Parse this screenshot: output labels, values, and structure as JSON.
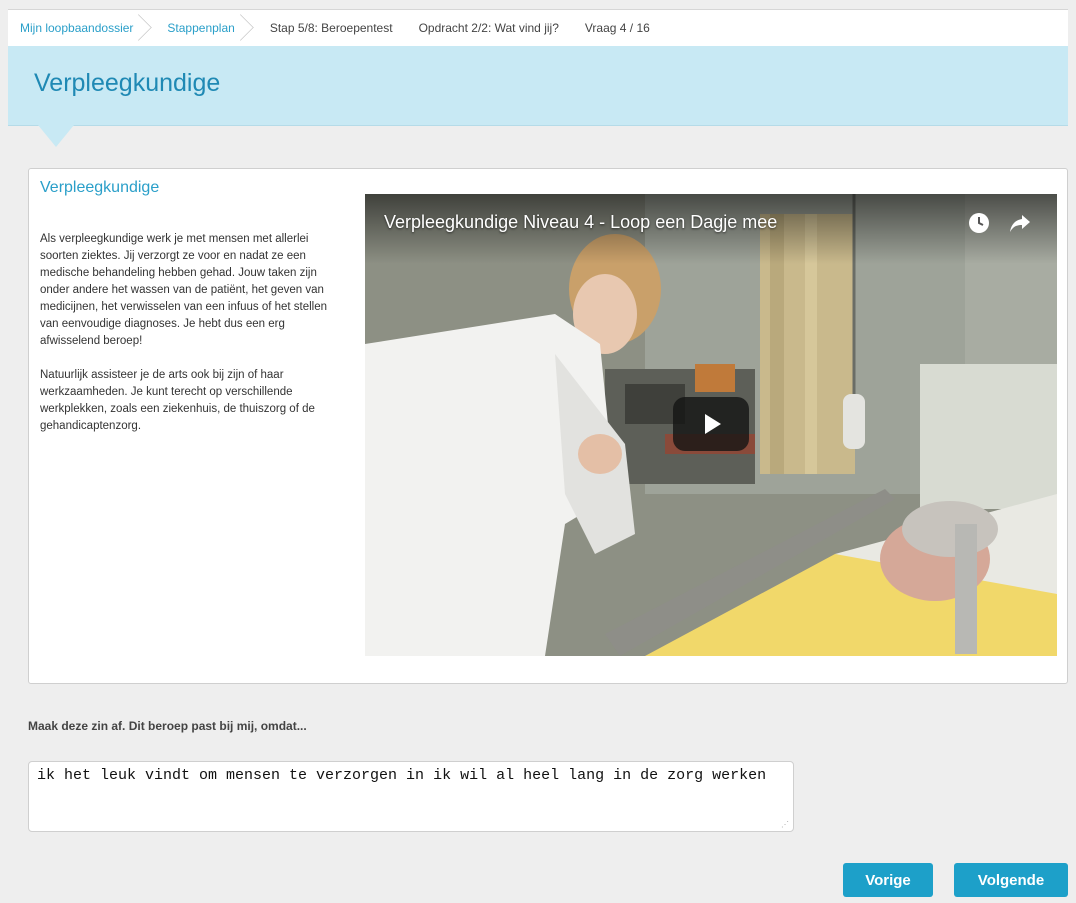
{
  "breadcrumb": {
    "items": [
      {
        "label": "Mijn loopbaandossier",
        "link": true
      },
      {
        "label": "Stappenplan",
        "link": true
      },
      {
        "label": "Stap 5/8: Beroepentest",
        "link": false
      },
      {
        "label": "Opdracht 2/2: Wat vind jij?",
        "link": false
      },
      {
        "label": "Vraag 4 / 16",
        "link": false
      }
    ]
  },
  "header": {
    "title": "Verpleegkundige"
  },
  "card": {
    "title": "Verpleegkundige",
    "paragraphs": [
      "Als verpleegkundige werk je met mensen met allerlei soorten ziektes. Jij verzorgt ze voor en nadat ze een medische behandeling hebben gehad. Jouw taken zijn onder andere het wassen van de patiënt, het geven van medicijnen, het verwisselen van een infuus of het stellen van eenvoudige diagnoses. Je hebt dus een erg afwisselend beroep!",
      "Natuurlijk assisteer je de arts ook bij zijn of haar werkzaamheden. Je kunt terecht op verschillende werkplekken, zoals een ziekenhuis, de thuiszorg of de gehandicaptenzorg."
    ]
  },
  "video": {
    "title": "Verpleegkundige Niveau 4 - Loop een Dagje mee",
    "icons": [
      "clock-icon",
      "share-icon",
      "play-icon"
    ]
  },
  "question": {
    "prompt": "Maak deze zin af. Dit beroep past bij mij, omdat...",
    "answer": "ik het leuk vindt om mensen te verzorgen in ik wil al heel lang in de zorg werken"
  },
  "buttons": {
    "previous": "Vorige",
    "next": "Volgende"
  },
  "colors": {
    "accent": "#1da0c9",
    "banner": "#c8e9f4",
    "title": "#1f89b4"
  }
}
